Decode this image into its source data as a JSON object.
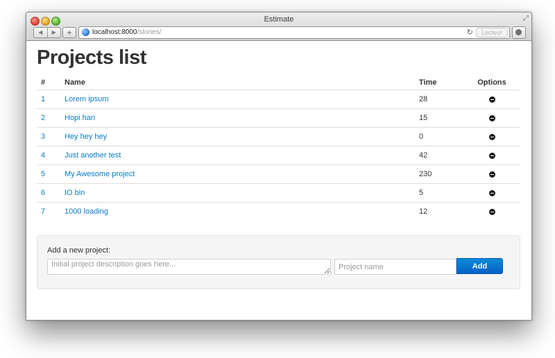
{
  "window": {
    "title": "Estimate",
    "url_host": "localhost:8000",
    "url_path": "/stories/",
    "reader_label": "Lecteur",
    "add_tab_label": "+",
    "back_symbol": "◀",
    "forward_symbol": "▶",
    "reload_symbol": "↻",
    "fullscreen_symbol": "⤢"
  },
  "page": {
    "heading": "Projects list",
    "table": {
      "columns": [
        "#",
        "Name",
        "Time",
        "Options"
      ],
      "rows": [
        {
          "id": "1",
          "name": "Lorem ipsum",
          "time": "28"
        },
        {
          "id": "2",
          "name": "Hopi hari",
          "time": "15"
        },
        {
          "id": "3",
          "name": "Hey hey hey",
          "time": "0"
        },
        {
          "id": "4",
          "name": "Just another test",
          "time": "42"
        },
        {
          "id": "5",
          "name": "My Awesome project",
          "time": "230"
        },
        {
          "id": "6",
          "name": "IO bin",
          "time": "5"
        },
        {
          "id": "7",
          "name": "1000 loading",
          "time": "12"
        }
      ],
      "option_icon": "remove-icon"
    },
    "new_project": {
      "label": "Add a new project:",
      "description_placeholder": "Initial project description goes here...",
      "description_value": "",
      "name_placeholder": "Project name",
      "name_value": "",
      "add_button": "Add"
    }
  },
  "colors": {
    "link": "#0a7bc2",
    "primary_button": "#0561c8",
    "heading": "#333333"
  }
}
